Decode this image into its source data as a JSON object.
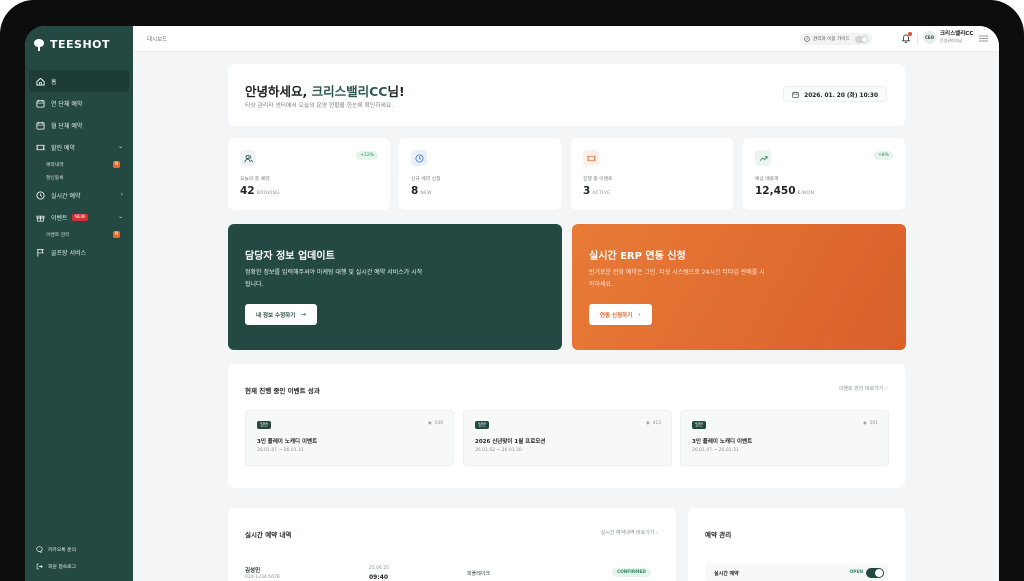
{
  "app": {
    "logo_text": "TEESHOT"
  },
  "sidebar": {
    "items": [
      {
        "label": "홈",
        "icon": "home-icon"
      },
      {
        "label": "연 단체 예약",
        "icon": "calendar-icon"
      },
      {
        "label": "월 단체 예약",
        "icon": "calendar-icon"
      },
      {
        "label": "할인 예약",
        "icon": "ticket-icon"
      },
      {
        "label": "실시간 예약",
        "icon": "clock-icon"
      },
      {
        "label": "이벤트",
        "icon": "gift-icon",
        "badge": "NEW"
      },
      {
        "label": "골프장 서비스",
        "icon": "flag-icon"
      }
    ],
    "sub_discount": [
      {
        "label": "예약내역",
        "badge": "N"
      },
      {
        "label": "할인등록"
      }
    ],
    "sub_event": [
      {
        "label": "이벤트 관리",
        "badge": "N"
      }
    ],
    "bottom": [
      {
        "label": "카카오톡 문의",
        "icon": "chat-icon"
      },
      {
        "label": "회원 접속로그",
        "icon": "logout-icon"
      }
    ]
  },
  "header": {
    "breadcrumb": "대시보드",
    "guide_label": "관리자 이용 가이드",
    "avatar_text": "CEO",
    "user_name": "크리스밸리CC",
    "user_role": "운영관리자님"
  },
  "welcome": {
    "greeting": "안녕하세요, ",
    "name": "크리스밸리CC",
    "suffix": "님!",
    "subtitle": "티샷 관리자 센터에서 오늘의 운영 현황을 한눈에 확인하세요.",
    "datetime": "2026. 01. 20 (화) 10:30"
  },
  "stats": [
    {
      "label": "오늘의 총 예약",
      "value": "42",
      "unit": "BOOKING",
      "delta": "+12%",
      "icon": "users-icon"
    },
    {
      "label": "신규 예약 신청",
      "value": "8",
      "unit": "NEW",
      "delta": "",
      "icon": "clock-icon"
    },
    {
      "label": "진행 중 이벤트",
      "value": "3",
      "unit": "ACTIVE",
      "delta": "",
      "icon": "ticket-icon"
    },
    {
      "label": "예상 매출액",
      "value": "12,450",
      "unit": "K-WON",
      "delta": "+8%",
      "icon": "trend-up-icon"
    }
  ],
  "banners": {
    "green": {
      "title": "담당자 정보 업데이트",
      "desc": "정확한 정보를 입력해주셔야 마케팅 대행 및 실시간 예약 서비스가 시작됩니다.",
      "button": "내 정보 수정하기"
    },
    "orange": {
      "title": "실시간 ERP 연동 신청",
      "desc": "번거로운 전화 예약은 그만. 티샷 시스템으로 24시간 티타임 판매를 시작하세요.",
      "button": "연동 신청하기"
    }
  },
  "events": {
    "title": "현재 진행 중인 이벤트 성과",
    "link": "이벤트 관리 바로가기",
    "cards": [
      {
        "tag": "일반",
        "views": "540",
        "title": "3인 플레이 노캐디 이벤트",
        "date": "26.01.07 ~ 26.01.31"
      },
      {
        "tag": "일반",
        "views": "413",
        "title": "2026 신년맞이 1월 프로모션",
        "date": "26.01.02 ~ 26.01.30"
      },
      {
        "tag": "일반",
        "views": "561",
        "title": "3인 플레이 노캐디 이벤트",
        "date": "26.01.07 ~ 26.01.31"
      }
    ]
  },
  "reservations": {
    "title": "실시간 예약 내역",
    "link": "실시간 예약내역 바로가기",
    "rows": [
      {
        "name": "김성민",
        "phone": "010-1234-5678",
        "date": "25.06.25",
        "time": "09:40",
        "course": "피플레이크",
        "status": "CONFIRMED"
      }
    ]
  },
  "manage": {
    "title": "예약 관리",
    "rows": [
      {
        "label": "실시간 예약",
        "status": "OPEN",
        "on": true
      }
    ]
  }
}
